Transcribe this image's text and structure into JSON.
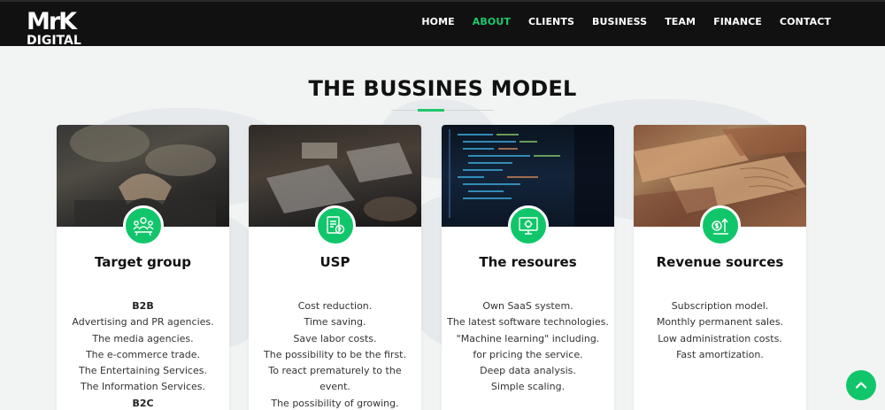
{
  "brand": {
    "line1": "MrK",
    "line2": "DIGITAL"
  },
  "nav": [
    {
      "label": "HOME",
      "active": false
    },
    {
      "label": "ABOUT",
      "active": true
    },
    {
      "label": "CLIENTS",
      "active": false
    },
    {
      "label": "BUSINESS",
      "active": false
    },
    {
      "label": "TEAM",
      "active": false
    },
    {
      "label": "FINANCE",
      "active": false
    },
    {
      "label": "CONTACT",
      "active": false
    }
  ],
  "section": {
    "title": "THE BUSSINES MODEL"
  },
  "colors": {
    "accent": "#1fc86d",
    "navbar": "#111111",
    "card": "#ffffff"
  },
  "cards": [
    {
      "icon": "target-group-icon",
      "title": "Target group",
      "lines": [
        "B2B",
        "Advertising and PR agencies.",
        "The media agencies.",
        "The e-commerce trade.",
        "The Entertaining Services.",
        "The Information Services.",
        "B2C"
      ]
    },
    {
      "icon": "usp-document-icon",
      "title": "USP",
      "lines": [
        "Cost reduction.",
        "Time saving.",
        "Save labor costs.",
        "The possibility to be the first.",
        "To react prematurely to the",
        "event.",
        "The possibility of growing."
      ]
    },
    {
      "icon": "computer-settings-icon",
      "title": "The resoures",
      "lines": [
        "Own SaaS system.",
        "The latest software technologies.",
        "\"Machine learning\" including.",
        "for pricing the service.",
        "Deep data analysis.",
        "Simple scaling."
      ]
    },
    {
      "icon": "revenue-growth-icon",
      "title": "Revenue sources",
      "lines": [
        "Subscription model.",
        "Monthly permanent sales.",
        "Low administration costs.",
        "Fast amortization."
      ]
    }
  ],
  "back_to_top_icon": "chevron-up-icon"
}
